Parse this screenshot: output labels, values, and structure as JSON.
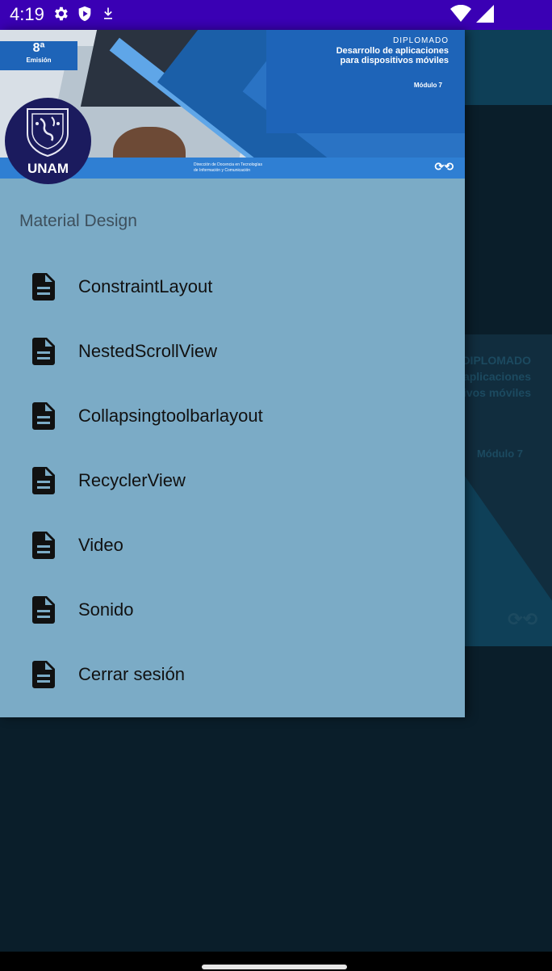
{
  "status_bar": {
    "time": "4:19",
    "left_icons": [
      "gear-icon",
      "shield-icon",
      "download-icon"
    ],
    "right_icons": [
      "wifi-icon",
      "signal-icon"
    ]
  },
  "drawer": {
    "header": {
      "edition_number": "8ª",
      "edition_word": "Emisión",
      "diplomado": "DIPLOMADO",
      "title_line1": "Desarrollo de aplicaciones",
      "title_line2": "para dispositivos móviles",
      "module": "Módulo 7",
      "footer_line1": "Dirección de Docencia en Tecnologías",
      "footer_line2": "de Información y Comunicación",
      "avatar_text": "UNAM"
    },
    "section_title": "Material Design",
    "items": [
      {
        "label": "ConstraintLayout",
        "icon": "document-icon"
      },
      {
        "label": "NestedScrollView",
        "icon": "document-icon"
      },
      {
        "label": "Collapsingtoolbarlayout",
        "icon": "document-icon"
      },
      {
        "label": "RecyclerView",
        "icon": "document-icon"
      },
      {
        "label": "Video",
        "icon": "document-icon"
      },
      {
        "label": "Sonido",
        "icon": "document-icon"
      },
      {
        "label": "Cerrar sesión",
        "icon": "document-icon"
      }
    ]
  },
  "background": {
    "banner_diplomado": "DIPLOMADO",
    "banner_line1": "Desarrollo de aplicaciones",
    "banner_line2": "para dispositivos móviles",
    "banner_module": "Módulo 7"
  },
  "colors": {
    "status_bar": "#3a00b4",
    "drawer_bg": "#7babc6",
    "scrim": "#0a1e2a"
  }
}
